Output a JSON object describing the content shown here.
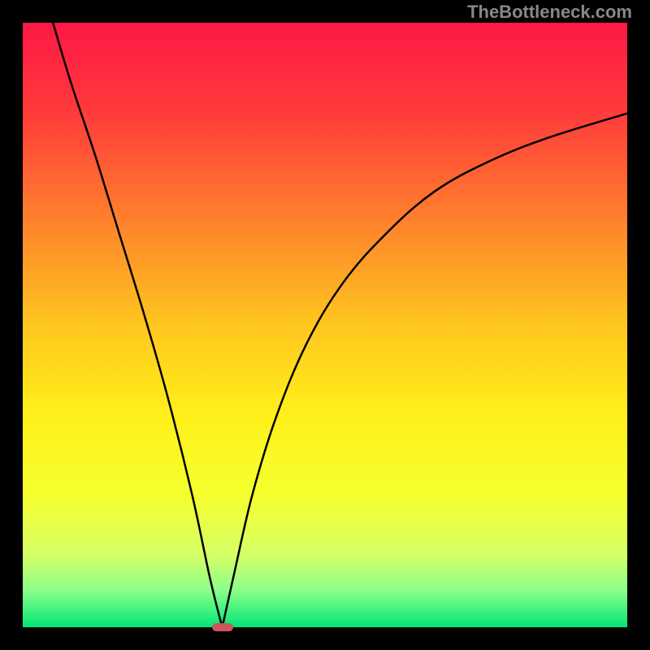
{
  "watermark": "TheBottleneck.com",
  "chart_data": {
    "type": "line",
    "title": "",
    "xlabel": "",
    "ylabel": "",
    "xlim": [
      0,
      100
    ],
    "ylim": [
      0,
      100
    ],
    "background_gradient": {
      "stops": [
        {
          "offset": 0,
          "color": "#ff1845"
        },
        {
          "offset": 15,
          "color": "#ff3b3b"
        },
        {
          "offset": 35,
          "color": "#ff8a2a"
        },
        {
          "offset": 50,
          "color": "#ffc61f"
        },
        {
          "offset": 65,
          "color": "#fff01a"
        },
        {
          "offset": 78,
          "color": "#f5ff2e"
        },
        {
          "offset": 88,
          "color": "#d6ff66"
        },
        {
          "offset": 94,
          "color": "#8aff8a"
        },
        {
          "offset": 100,
          "color": "#00e676"
        }
      ]
    },
    "curve": {
      "minimum_x": 33,
      "left_branch": [
        {
          "x": 5,
          "y": 100
        },
        {
          "x": 8,
          "y": 90
        },
        {
          "x": 12,
          "y": 78
        },
        {
          "x": 16,
          "y": 65
        },
        {
          "x": 20,
          "y": 52
        },
        {
          "x": 24,
          "y": 38
        },
        {
          "x": 28,
          "y": 22
        },
        {
          "x": 31,
          "y": 8
        },
        {
          "x": 33,
          "y": 0
        }
      ],
      "right_branch": [
        {
          "x": 33,
          "y": 0
        },
        {
          "x": 35,
          "y": 9
        },
        {
          "x": 38,
          "y": 22
        },
        {
          "x": 42,
          "y": 35
        },
        {
          "x": 47,
          "y": 47
        },
        {
          "x": 53,
          "y": 57
        },
        {
          "x": 60,
          "y": 65
        },
        {
          "x": 68,
          "y": 72
        },
        {
          "x": 77,
          "y": 77
        },
        {
          "x": 87,
          "y": 81
        },
        {
          "x": 100,
          "y": 85
        }
      ]
    },
    "marker": {
      "x": 33,
      "y": 0,
      "width_frac": 0.035,
      "height_frac": 0.013,
      "color": "#cc5560"
    }
  }
}
